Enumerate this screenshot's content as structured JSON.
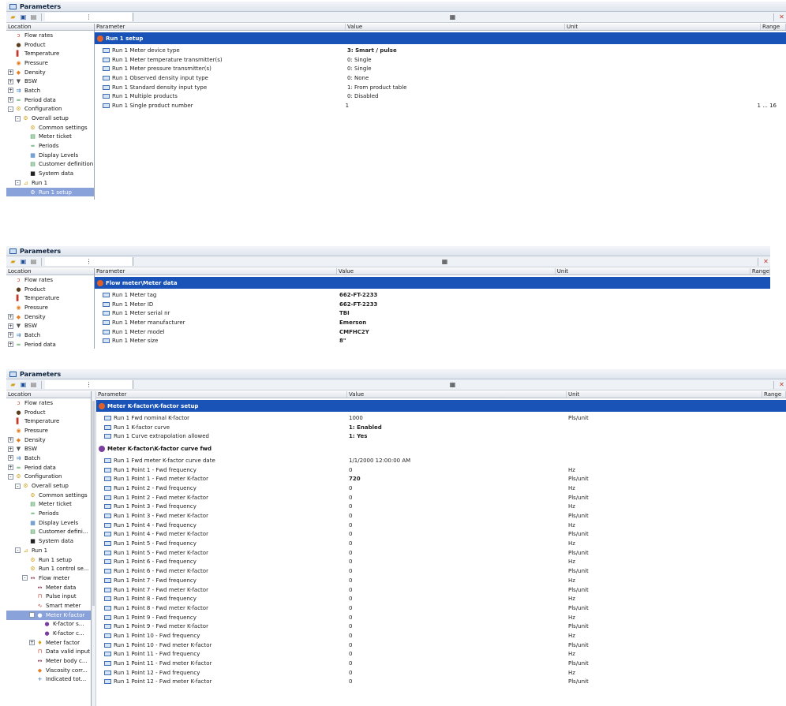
{
  "panels": [
    {
      "title": "Parameters",
      "tree_header": "Location",
      "columns": [
        "Parameter",
        "Value",
        "Unit",
        "Range"
      ],
      "tree": [
        {
          "label": "Flow rates",
          "icon": "flow-icon",
          "exp": ""
        },
        {
          "label": "Product",
          "icon": "drop-icon",
          "exp": ""
        },
        {
          "label": "Temperature",
          "icon": "thermometer-icon",
          "exp": ""
        },
        {
          "label": "Pressure",
          "icon": "gauge-icon",
          "exp": ""
        },
        {
          "label": "Density",
          "icon": "density-icon",
          "exp": "+"
        },
        {
          "label": "BSW",
          "icon": "funnel-icon",
          "exp": "+"
        },
        {
          "label": "Batch",
          "icon": "batch-icon",
          "exp": "+"
        },
        {
          "label": "Period data",
          "icon": "period-icon",
          "exp": "+"
        },
        {
          "label": "Configuration",
          "icon": "config-icon",
          "exp": "-"
        },
        {
          "label": "Overall setup",
          "icon": "config-icon",
          "exp": "-"
        },
        {
          "label": "Common settings",
          "icon": "config-icon",
          "exp": ""
        },
        {
          "label": "Meter ticket",
          "icon": "ticket-icon",
          "exp": ""
        },
        {
          "label": "Periods",
          "icon": "period-icon",
          "exp": ""
        },
        {
          "label": "Display Levels",
          "icon": "display-icon",
          "exp": ""
        },
        {
          "label": "Customer definition",
          "icon": "ticket-icon",
          "exp": ""
        },
        {
          "label": "System data",
          "icon": "monitor-icon",
          "exp": ""
        },
        {
          "label": "Run 1",
          "icon": "run-icon",
          "exp": "-"
        },
        {
          "label": "Run 1 setup",
          "icon": "config-icon",
          "exp": "",
          "selected": true
        }
      ],
      "sections": [
        {
          "title": "Run 1 setup",
          "rows": [
            {
              "param": "Run 1 Meter device type",
              "value": "3: Smart / pulse",
              "bold": true,
              "unit": "",
              "range": ""
            },
            {
              "param": "Run 1 Meter temperature transmitter(s)",
              "value": "0: Single",
              "unit": "",
              "range": ""
            },
            {
              "param": "Run 1 Meter pressure transmitter(s)",
              "value": "0: Single",
              "unit": "",
              "range": ""
            },
            {
              "param": "Run 1 Observed density input type",
              "value": "0: None",
              "unit": "",
              "range": ""
            },
            {
              "param": "Run 1 Standard density input type",
              "value": "1: From product table",
              "unit": "",
              "range": ""
            },
            {
              "param": "Run 1 Multiple products",
              "value": "0: Disabled",
              "unit": "",
              "range": ""
            },
            {
              "param": "Run 1 Single product number",
              "value": "1",
              "unit": "",
              "range": "1 ... 16"
            }
          ]
        }
      ]
    },
    {
      "title": "Parameters",
      "tree_header": "Location",
      "columns": [
        "Parameter",
        "Value",
        "Unit",
        "Range"
      ],
      "tree": [
        {
          "label": "Flow rates",
          "icon": "flow-icon",
          "exp": ""
        },
        {
          "label": "Product",
          "icon": "drop-icon",
          "exp": ""
        },
        {
          "label": "Temperature",
          "icon": "thermometer-icon",
          "exp": ""
        },
        {
          "label": "Pressure",
          "icon": "gauge-icon",
          "exp": ""
        },
        {
          "label": "Density",
          "icon": "density-icon",
          "exp": "+"
        },
        {
          "label": "BSW",
          "icon": "funnel-icon",
          "exp": "+"
        },
        {
          "label": "Batch",
          "icon": "batch-icon",
          "exp": "+"
        },
        {
          "label": "Period data",
          "icon": "period-icon",
          "exp": "+"
        }
      ],
      "sections": [
        {
          "title": "Flow meter\\Meter data",
          "rows": [
            {
              "param": "Run 1 Meter tag",
              "value": "662-FT-2233",
              "bold": true,
              "unit": "",
              "range": ""
            },
            {
              "param": "Run 1 Meter ID",
              "value": "662-FT-2233",
              "bold": true,
              "unit": "",
              "range": ""
            },
            {
              "param": "Run 1 Meter serial nr",
              "value": "TBI",
              "bold": true,
              "unit": "",
              "range": ""
            },
            {
              "param": "Run 1 Meter manufacturer",
              "value": "Emerson",
              "bold": true,
              "unit": "",
              "range": ""
            },
            {
              "param": "Run 1 Meter model",
              "value": "CMFHC2Y",
              "bold": true,
              "unit": "",
              "range": ""
            },
            {
              "param": "Run 1 Meter size",
              "value": "8\"",
              "bold": true,
              "unit": "",
              "range": ""
            }
          ]
        }
      ]
    },
    {
      "title": "Parameters",
      "tree_header": "Location",
      "columns": [
        "Parameter",
        "Value",
        "Unit",
        "Range"
      ],
      "tree": [
        {
          "label": "Flow rates",
          "icon": "flow-icon",
          "exp": ""
        },
        {
          "label": "Product",
          "icon": "drop-icon",
          "exp": ""
        },
        {
          "label": "Temperature",
          "icon": "thermometer-icon",
          "exp": ""
        },
        {
          "label": "Pressure",
          "icon": "gauge-icon",
          "exp": ""
        },
        {
          "label": "Density",
          "icon": "density-icon",
          "exp": "+"
        },
        {
          "label": "BSW",
          "icon": "funnel-icon",
          "exp": "+"
        },
        {
          "label": "Batch",
          "icon": "batch-icon",
          "exp": "+"
        },
        {
          "label": "Period data",
          "icon": "period-icon",
          "exp": "+"
        },
        {
          "label": "Configuration",
          "icon": "config-icon",
          "exp": "-"
        },
        {
          "label": "Overall setup",
          "icon": "config-icon",
          "exp": "-"
        },
        {
          "label": "Common settings",
          "icon": "config-icon",
          "exp": ""
        },
        {
          "label": "Meter ticket",
          "icon": "ticket-icon",
          "exp": ""
        },
        {
          "label": "Periods",
          "icon": "period-icon",
          "exp": ""
        },
        {
          "label": "Display Levels",
          "icon": "display-icon",
          "exp": ""
        },
        {
          "label": "Customer defini...",
          "icon": "ticket-icon",
          "exp": ""
        },
        {
          "label": "System data",
          "icon": "monitor-icon",
          "exp": ""
        },
        {
          "label": "Run 1",
          "icon": "run-icon",
          "exp": "-"
        },
        {
          "label": "Run 1 setup",
          "icon": "config-icon",
          "exp": ""
        },
        {
          "label": "Run 1 control se...",
          "icon": "config-icon",
          "exp": ""
        },
        {
          "label": "Flow meter",
          "icon": "meter-icon",
          "exp": "-"
        },
        {
          "label": "Meter data",
          "icon": "meter-icon",
          "exp": ""
        },
        {
          "label": "Pulse input",
          "icon": "pulse-icon",
          "exp": ""
        },
        {
          "label": "Smart meter",
          "icon": "wave-icon",
          "exp": ""
        },
        {
          "label": "Meter K-factor",
          "icon": "kfactor-icon",
          "exp": "-",
          "selected": true
        },
        {
          "label": "K-factor s...",
          "icon": "kfactor-icon",
          "exp": ""
        },
        {
          "label": "K-factor c...",
          "icon": "kfactor-icon",
          "exp": ""
        },
        {
          "label": "Meter factor",
          "icon": "trophy-icon",
          "exp": "+"
        },
        {
          "label": "Data valid input",
          "icon": "pulse-icon",
          "exp": ""
        },
        {
          "label": "Meter body c...",
          "icon": "meter-icon",
          "exp": ""
        },
        {
          "label": "Viscosity corr...",
          "icon": "density-icon",
          "exp": ""
        },
        {
          "label": "Indicated tot...",
          "icon": "plus-icon",
          "exp": ""
        }
      ],
      "sections": [
        {
          "title": "Meter K-factor\\K-factor setup",
          "rows": [
            {
              "param": "Run 1 Fwd nominal K-factor",
              "value": "1000",
              "unit": "Pls/unit",
              "range": ""
            },
            {
              "param": "Run 1 K-factor curve",
              "value": "1: Enabled",
              "bold": true,
              "unit": "",
              "range": ""
            },
            {
              "param": "Run 1 Curve extrapolation allowed",
              "value": "1: Yes",
              "bold": true,
              "unit": "",
              "range": ""
            }
          ]
        },
        {
          "title": "Meter K-factor\\K-factor curve fwd",
          "light": true,
          "rows": [
            {
              "param": "Run 1 Fwd meter K-factor curve date",
              "value": "1/1/2000 12:00:00 AM",
              "unit": "",
              "range": ""
            },
            {
              "param": "Run 1 Point 1 - Fwd frequency",
              "value": "0",
              "unit": "Hz",
              "range": ""
            },
            {
              "param": "Run 1 Point 1 - Fwd meter K-factor",
              "value": "720",
              "bold": true,
              "unit": "Pls/unit",
              "range": ""
            },
            {
              "param": "Run 1 Point 2 - Fwd frequency",
              "value": "0",
              "unit": "Hz",
              "range": ""
            },
            {
              "param": "Run 1 Point 2 - Fwd meter K-factor",
              "value": "0",
              "unit": "Pls/unit",
              "range": ""
            },
            {
              "param": "Run 1 Point 3 - Fwd frequency",
              "value": "0",
              "unit": "Hz",
              "range": ""
            },
            {
              "param": "Run 1 Point 3 - Fwd meter K-factor",
              "value": "0",
              "unit": "Pls/unit",
              "range": ""
            },
            {
              "param": "Run 1 Point 4 - Fwd frequency",
              "value": "0",
              "unit": "Hz",
              "range": ""
            },
            {
              "param": "Run 1 Point 4 - Fwd meter K-factor",
              "value": "0",
              "unit": "Pls/unit",
              "range": ""
            },
            {
              "param": "Run 1 Point 5 - Fwd frequency",
              "value": "0",
              "unit": "Hz",
              "range": ""
            },
            {
              "param": "Run 1 Point 5 - Fwd meter K-factor",
              "value": "0",
              "unit": "Pls/unit",
              "range": ""
            },
            {
              "param": "Run 1 Point 6 - Fwd frequency",
              "value": "0",
              "unit": "Hz",
              "range": ""
            },
            {
              "param": "Run 1 Point 6 - Fwd meter K-factor",
              "value": "0",
              "unit": "Pls/unit",
              "range": ""
            },
            {
              "param": "Run 1 Point 7 - Fwd frequency",
              "value": "0",
              "unit": "Hz",
              "range": ""
            },
            {
              "param": "Run 1 Point 7 - Fwd meter K-factor",
              "value": "0",
              "unit": "Pls/unit",
              "range": ""
            },
            {
              "param": "Run 1 Point 8 - Fwd frequency",
              "value": "0",
              "unit": "Hz",
              "range": ""
            },
            {
              "param": "Run 1 Point 8 - Fwd meter K-factor",
              "value": "0",
              "unit": "Pls/unit",
              "range": ""
            },
            {
              "param": "Run 1 Point 9 - Fwd frequency",
              "value": "0",
              "unit": "Hz",
              "range": ""
            },
            {
              "param": "Run 1 Point 9 - Fwd meter K-factor",
              "value": "0",
              "unit": "Pls/unit",
              "range": ""
            },
            {
              "param": "Run 1 Point 10 - Fwd frequency",
              "value": "0",
              "unit": "Hz",
              "range": ""
            },
            {
              "param": "Run 1 Point 10 - Fwd meter K-factor",
              "value": "0",
              "unit": "Pls/unit",
              "range": ""
            },
            {
              "param": "Run 1 Point 11 - Fwd frequency",
              "value": "0",
              "unit": "Hz",
              "range": ""
            },
            {
              "param": "Run 1 Point 11 - Fwd meter K-factor",
              "value": "0",
              "unit": "Pls/unit",
              "range": ""
            },
            {
              "param": "Run 1 Point 12 - Fwd frequency",
              "value": "0",
              "unit": "Hz",
              "range": ""
            },
            {
              "param": "Run 1 Point 12 - Fwd meter K-factor",
              "value": "0",
              "unit": "Pls/unit",
              "range": ""
            }
          ]
        }
      ]
    }
  ],
  "toolbar_icons": [
    "open-folder-icon",
    "save-icon",
    "print-icon",
    "tree-view-icon",
    "grid-view-icon",
    "filter-icon"
  ],
  "colors": {
    "section_blue": "#1a53b7",
    "selection": "#8aa2da"
  }
}
